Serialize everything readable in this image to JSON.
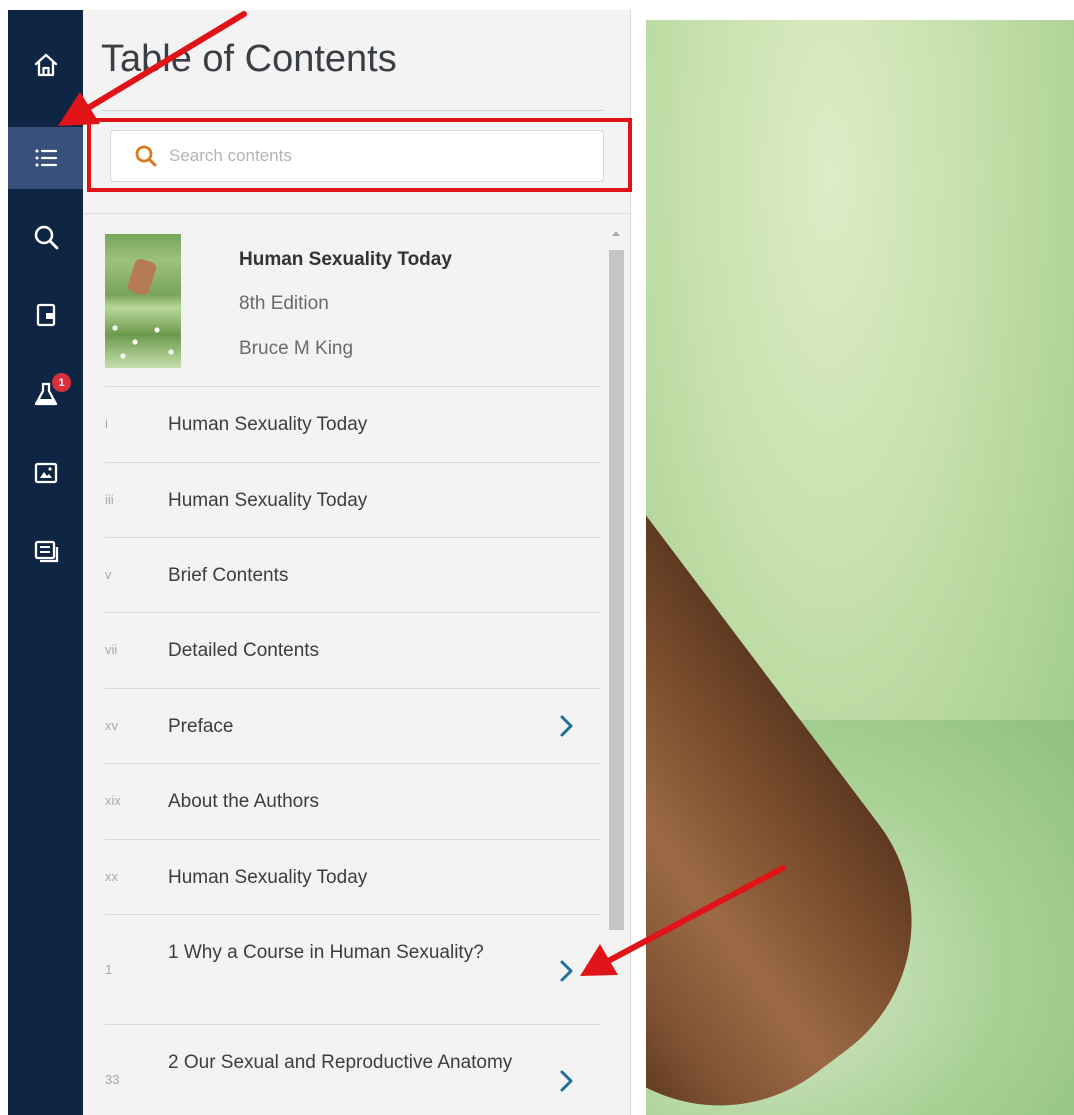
{
  "toc": {
    "title": "Table of Contents",
    "search": {
      "placeholder": "Search contents"
    },
    "book": {
      "title": "Human Sexuality Today",
      "edition": "8th Edition",
      "author": "Bruce M King"
    },
    "entries": [
      {
        "page": "i",
        "label": "Human Sexuality Today",
        "has_children": false
      },
      {
        "page": "iii",
        "label": "Human Sexuality Today",
        "has_children": false
      },
      {
        "page": "v",
        "label": "Brief Contents",
        "has_children": false
      },
      {
        "page": "vii",
        "label": "Detailed Contents",
        "has_children": false
      },
      {
        "page": "xv",
        "label": "Preface",
        "has_children": true
      },
      {
        "page": "xix",
        "label": "About the Authors",
        "has_children": false
      },
      {
        "page": "xx",
        "label": "Human Sexuality Today",
        "has_children": false
      },
      {
        "page": "1",
        "label": "1 Why a Course in Human Sexuality?",
        "has_children": true
      },
      {
        "page": "33",
        "label": "2 Our Sexual and Reproductive Anatomy",
        "has_children": true
      }
    ]
  },
  "sidebar": {
    "items": [
      {
        "icon": "home-icon",
        "active": false
      },
      {
        "icon": "list-icon",
        "active": true
      },
      {
        "icon": "search-icon",
        "active": false
      },
      {
        "icon": "bookmark-page-icon",
        "active": false
      },
      {
        "icon": "flask-icon",
        "active": false,
        "badge": "1"
      },
      {
        "icon": "image-icon",
        "active": false
      },
      {
        "icon": "notes-icon",
        "active": false
      }
    ]
  },
  "colors": {
    "rail_bg": "#0e2544",
    "rail_active": "#39517a",
    "search_icon": "#d97a1c",
    "chevron": "#1f6f9c",
    "annotation_red": "#e01418"
  }
}
